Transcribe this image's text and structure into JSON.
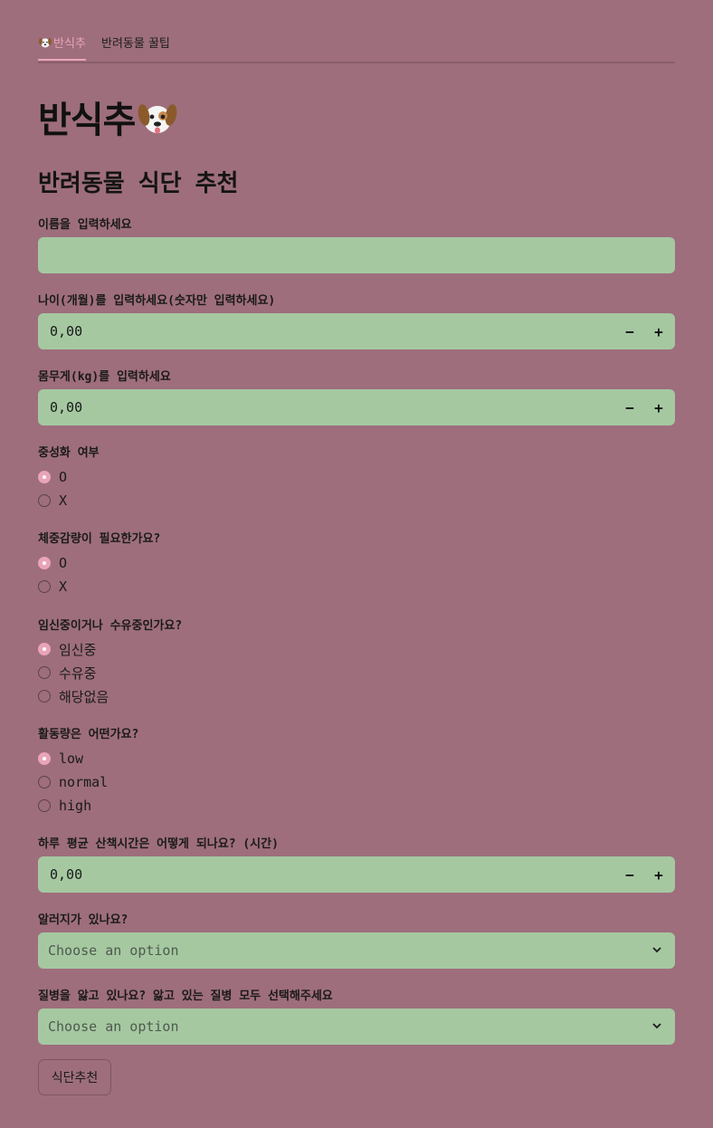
{
  "tabs": [
    {
      "label": "반식추",
      "icon": "dog-face-icon",
      "active": true
    },
    {
      "label": "반려동물 꿀팁",
      "active": false
    }
  ],
  "title": "반식추",
  "subtitle": "반려동물 식단 추천",
  "name_field": {
    "label": "이름을 입력하세요",
    "value": ""
  },
  "age_field": {
    "label": "나이(개월)를 입력하세요(숫자만 입력하세요)",
    "value": "0,00",
    "minus": "−",
    "plus": "+"
  },
  "weight_field": {
    "label": "몸무게(kg)를 입력하세요",
    "value": "0,00",
    "minus": "−",
    "plus": "+"
  },
  "neutered": {
    "label": "중성화 여부",
    "options": [
      "O",
      "X"
    ],
    "selected": "O"
  },
  "diet": {
    "label": "체중감량이 필요한가요?",
    "options": [
      "O",
      "X"
    ],
    "selected": "O"
  },
  "pregnancy": {
    "label": "임신중이거나 수유중인가요?",
    "options": [
      "임신중",
      "수유중",
      "해당없음"
    ],
    "selected": "임신중"
  },
  "activity": {
    "label": "활동량은 어떤가요?",
    "options": [
      "low",
      "normal",
      "high"
    ],
    "selected": "low"
  },
  "walk_field": {
    "label": "하루 평균 산책시간은 어떻게 되나요? (시간)",
    "value": "0,00",
    "minus": "−",
    "plus": "+"
  },
  "allergy": {
    "label": "알러지가 있나요?",
    "placeholder": "Choose an option"
  },
  "disease": {
    "label": "질병을 앓고 있나요? 앓고 있는 질병 모두 선택해주세요",
    "placeholder": "Choose an option"
  },
  "submit_label": "식단추천",
  "colors": {
    "background": "#9e6e7c",
    "field": "#a5c8a1",
    "accent": "#e9a4b8"
  }
}
